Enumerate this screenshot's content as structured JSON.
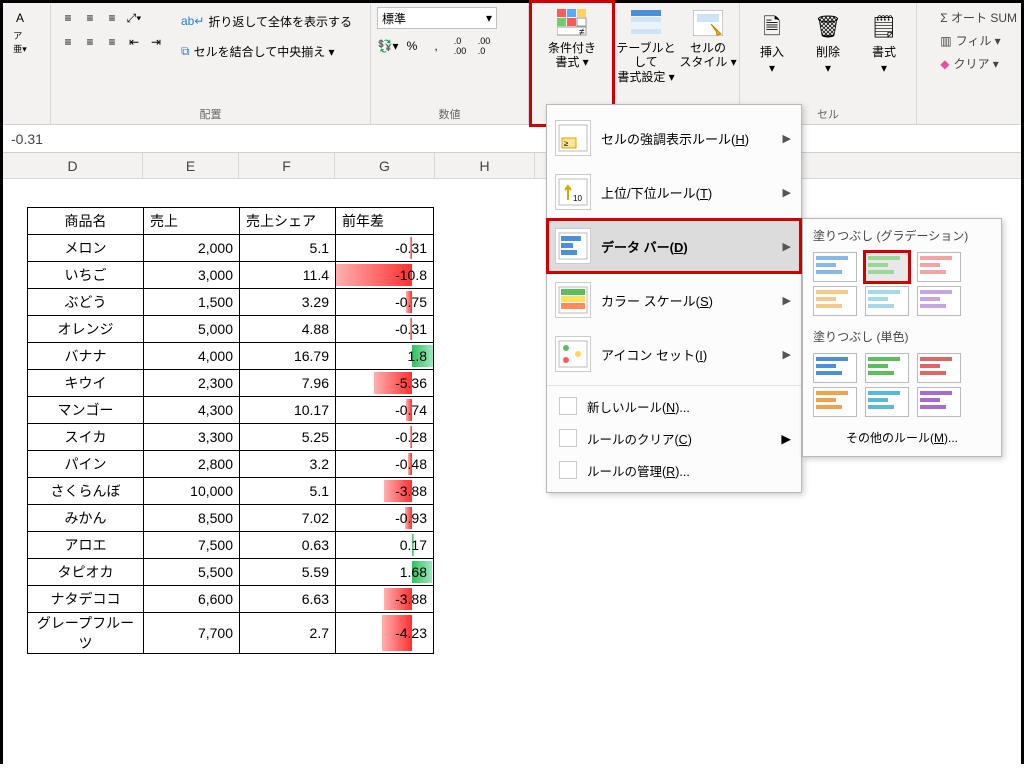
{
  "ribbon": {
    "align_group_label": "配置",
    "number_group_label": "数値",
    "cells_group_label": "セル",
    "wrap_text": "折り返して全体を表示する",
    "merge_center": "セルを結合して中央揃え ▾",
    "number_format_selected": "標準",
    "cond_format": "条件付き\n書式 ▾",
    "format_table": "テーブルとして\n書式設定 ▾",
    "cell_styles": "セルの\nスタイル ▾",
    "insert": "挿入",
    "delete": "削除",
    "format": "書式",
    "autosum": "Σ オート SUM",
    "fill": "フィル ▾",
    "clear": "クリア ▾"
  },
  "formula_bar_value": "-0.31",
  "columns": [
    "D",
    "E",
    "F",
    "G",
    "H"
  ],
  "headers": {
    "name": "商品名",
    "sales": "売上",
    "share": "売上シェア",
    "diff": "前年差"
  },
  "rows": [
    {
      "name": "メロン",
      "sales": "2,000",
      "share": "5.1",
      "diff": -0.31
    },
    {
      "name": "いちご",
      "sales": "3,000",
      "share": "11.4",
      "diff": -10.8
    },
    {
      "name": "ぶどう",
      "sales": "1,500",
      "share": "3.29",
      "diff": -0.75
    },
    {
      "name": "オレンジ",
      "sales": "5,000",
      "share": "4.88",
      "diff": -0.31
    },
    {
      "name": "バナナ",
      "sales": "4,000",
      "share": "16.79",
      "diff": 1.8
    },
    {
      "name": "キウイ",
      "sales": "2,300",
      "share": "7.96",
      "diff": -5.36
    },
    {
      "name": "マンゴー",
      "sales": "4,300",
      "share": "10.17",
      "diff": -0.74
    },
    {
      "name": "スイカ",
      "sales": "3,300",
      "share": "5.25",
      "diff": -0.28
    },
    {
      "name": "パイン",
      "sales": "2,800",
      "share": "3.2",
      "diff": -0.48
    },
    {
      "name": "さくらんぼ",
      "sales": "10,000",
      "share": "5.1",
      "diff": -3.88
    },
    {
      "name": "みかん",
      "sales": "8,500",
      "share": "7.02",
      "diff": -0.93
    },
    {
      "name": "アロエ",
      "sales": "7,500",
      "share": "0.63",
      "diff": 0.17
    },
    {
      "name": "タピオカ",
      "sales": "5,500",
      "share": "5.59",
      "diff": 1.68
    },
    {
      "name": "ナタデココ",
      "sales": "6,600",
      "share": "6.63",
      "diff": -3.88
    },
    {
      "name": "グレープフルーツ",
      "sales": "7,700",
      "share": "2.7",
      "diff": -4.23
    }
  ],
  "menu": {
    "highlight_rules": "セルの強調表示ルール(",
    "highlight_rules_key": "H",
    "top_bottom": "上位/下位ルール(",
    "top_bottom_key": "T",
    "data_bars": "データ バー(",
    "data_bars_key": "D",
    "color_scales": "カラー スケール(",
    "color_scales_key": "S",
    "icon_sets": "アイコン セット(",
    "icon_sets_key": "I",
    "new_rule": "新しいルール(",
    "new_rule_key": "N",
    "clear_rules": "ルールのクリア(",
    "clear_rules_key": "C",
    "manage_rules": "ルールの管理(",
    "manage_rules_key": "R",
    "close_paren": ")",
    "ellipsis": "..."
  },
  "submenu": {
    "gradient_title": "塗りつぶし (グラデーション)",
    "solid_title": "塗りつぶし (単色)",
    "more_rules": "その他のルール(",
    "more_rules_key": "M",
    "close_paren": ")",
    "ellipsis": "..."
  }
}
